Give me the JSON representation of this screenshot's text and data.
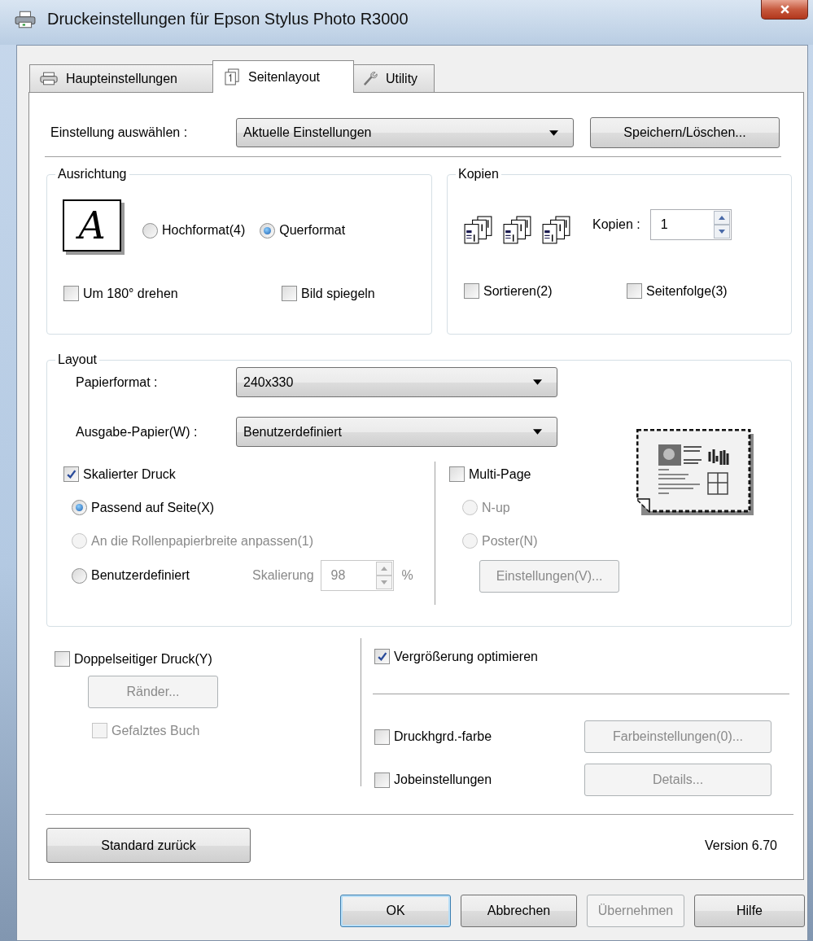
{
  "window": {
    "title": "Druckeinstellungen für Epson Stylus Photo R3000"
  },
  "tabs": [
    {
      "label": "Haupteinstellungen",
      "selected": false
    },
    {
      "label": "Seitenlayout",
      "selected": true
    },
    {
      "label": "Utility",
      "selected": false
    }
  ],
  "preset": {
    "label": "Einstellung auswählen :",
    "value": "Aktuelle Einstellungen",
    "button": "Speichern/Löschen..."
  },
  "orientation": {
    "title": "Ausrichtung",
    "preview_letter": "A",
    "options": [
      {
        "label": "Hochformat(4)",
        "selected": false
      },
      {
        "label": "Querformat",
        "selected": true
      }
    ],
    "checks": [
      {
        "label": "Um 180° drehen",
        "checked": false
      },
      {
        "label": "Bild spiegeln",
        "checked": false
      }
    ]
  },
  "copies": {
    "title": "Kopien",
    "label": "Kopien :",
    "value": "1",
    "checks": [
      {
        "label": "Sortieren(2)",
        "checked": false
      },
      {
        "label": "Seitenfolge(3)",
        "checked": false
      }
    ]
  },
  "layout": {
    "title": "Layout",
    "fields": [
      {
        "label": "Papierformat :",
        "value": "240x330"
      },
      {
        "label": "Ausgabe-Papier(W) :",
        "value": "Benutzerdefiniert"
      }
    ],
    "scaled": {
      "label": "Skalierter Druck",
      "checked": true
    },
    "scale_options": [
      {
        "label": "Passend auf Seite(X)",
        "selected": true,
        "disabled": false
      },
      {
        "label": "An die Rollenpapierbreite anpassen(1)",
        "selected": false,
        "disabled": true
      },
      {
        "label": "Benutzerdefiniert",
        "selected": false,
        "disabled": false
      }
    ],
    "scaling": {
      "label": "Skalierung",
      "value": "98",
      "unit": "%",
      "disabled": true
    },
    "multi_page": {
      "label": "Multi-Page",
      "checked": false
    },
    "multi_options": [
      {
        "label": "N-up",
        "selected": false,
        "disabled": true
      },
      {
        "label": "Poster(N)",
        "selected": false,
        "disabled": true
      }
    ],
    "multi_button": {
      "label": "Einstellungen(V)...",
      "disabled": true
    }
  },
  "duplex": {
    "label": "Doppelseitiger Druck(Y)",
    "checked": false
  },
  "margins_button": {
    "label": "Ränder...",
    "disabled": true
  },
  "booklet": {
    "label": "Gefalztes Buch",
    "checked": false,
    "disabled": true
  },
  "enlarge": {
    "label": "Vergrößerung optimieren",
    "checked": true
  },
  "extras": [
    {
      "label": "Druckhgrd.-farbe",
      "checked": false,
      "button": {
        "label": "Farbeinstellungen(0)...",
        "disabled": true
      }
    },
    {
      "label": "Jobeinstellungen",
      "checked": false,
      "button": {
        "label": "Details...",
        "disabled": true
      }
    }
  ],
  "reset_button": "Standard zurück",
  "version": "Version 6.70",
  "buttons": [
    {
      "label": "OK",
      "kind": "default",
      "disabled": false
    },
    {
      "label": "Abbrechen",
      "kind": "normal",
      "disabled": false
    },
    {
      "label": "Übernehmen",
      "kind": "normal",
      "disabled": true
    },
    {
      "label": "Hilfe",
      "kind": "normal",
      "disabled": false
    }
  ]
}
